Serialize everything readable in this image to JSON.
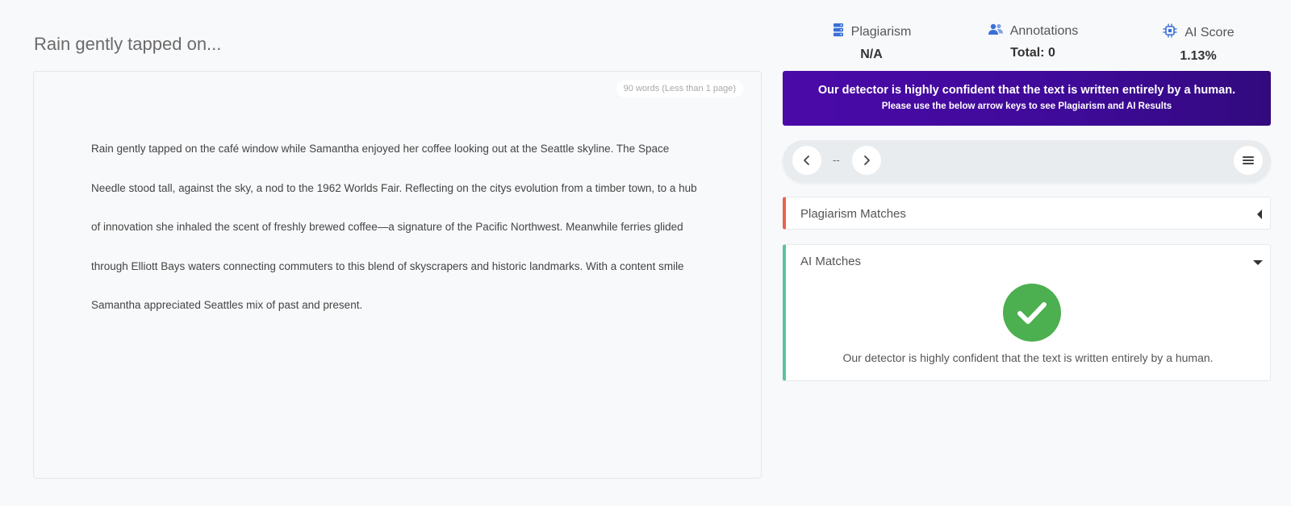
{
  "document": {
    "title": "Rain gently tapped on...",
    "word_count": "90 words (Less than 1 page)",
    "lines": [
      "Rain gently tapped on the café window while Samantha enjoyed her coffee looking out at the Seattle skyline. The Space",
      "Needle stood tall, against the sky, a nod to the 1962 Worlds Fair. Reflecting on the citys evolution from a timber town, to a hub",
      "of innovation she inhaled the scent of freshly brewed coffee—a signature of the Pacific Northwest. Meanwhile ferries glided",
      "through Elliott Bays waters connecting commuters to this blend of skyscrapers and historic landmarks. With a content smile",
      "Samantha appreciated Seattles mix of past and present."
    ]
  },
  "stats": {
    "plagiarism": {
      "label": "Plagiarism",
      "value": "N/A",
      "icon": "database-icon"
    },
    "annotations": {
      "label": "Annotations",
      "value": "Total: 0",
      "icon": "users-icon"
    },
    "ai_score": {
      "label": "AI Score",
      "value": "1.13%",
      "icon": "chip-icon"
    }
  },
  "banner": {
    "title": "Our detector is highly confident that the text is written entirely by a human.",
    "subtitle": "Please use the below arrow keys to see Plagiarism and AI Results"
  },
  "navigation": {
    "position": "--"
  },
  "plagiarism_matches": {
    "header": "Plagiarism Matches",
    "accent": "#e8634f"
  },
  "ai_matches": {
    "header": "AI Matches",
    "accent": "#5cc49a",
    "result_text": "Our detector is highly confident that the text is written entirely by a human.",
    "result_icon": "check-icon",
    "result_color": "#4caf50"
  },
  "colors": {
    "banner_start": "#4b0aa9",
    "banner_end": "#320a7e",
    "icon_blue": "#3b6fd8"
  }
}
